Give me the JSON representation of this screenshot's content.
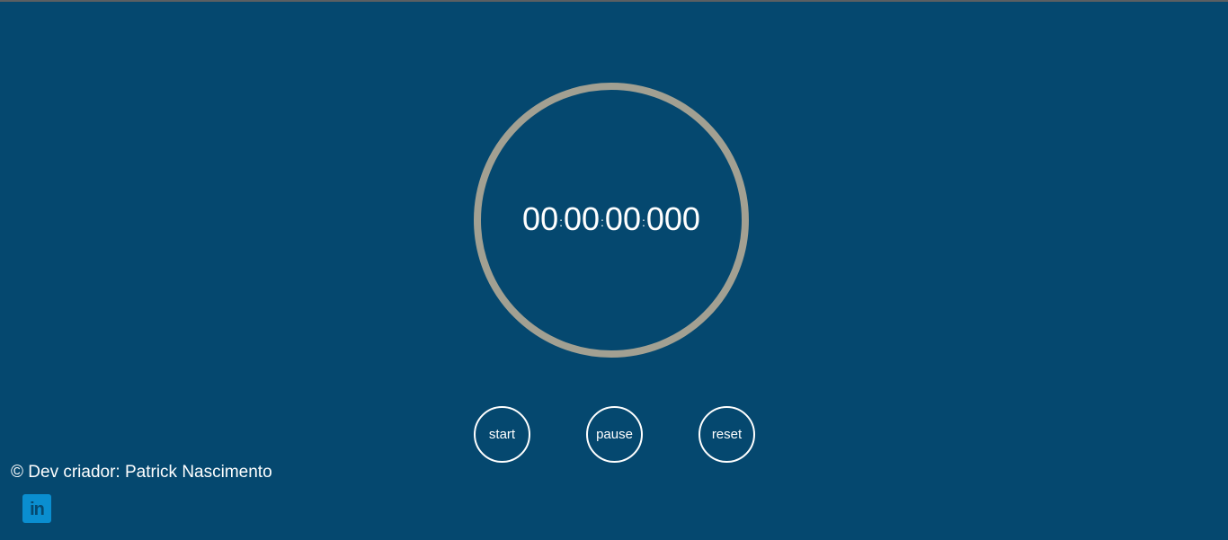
{
  "timer": {
    "hours": "00",
    "minutes": "00",
    "seconds": "00",
    "milliseconds": "000",
    "separator": ":"
  },
  "controls": {
    "start_label": "start",
    "pause_label": "pause",
    "reset_label": "reset"
  },
  "footer": {
    "credit": "© Dev criador: Patrick Nascimento",
    "linkedin_glyph": "in",
    "linkedin_icon": "linkedin-icon"
  },
  "colors": {
    "background": "#05486f",
    "ring": "#a2a092",
    "text": "#ffffff",
    "linkedin": "#0a8ed0"
  }
}
